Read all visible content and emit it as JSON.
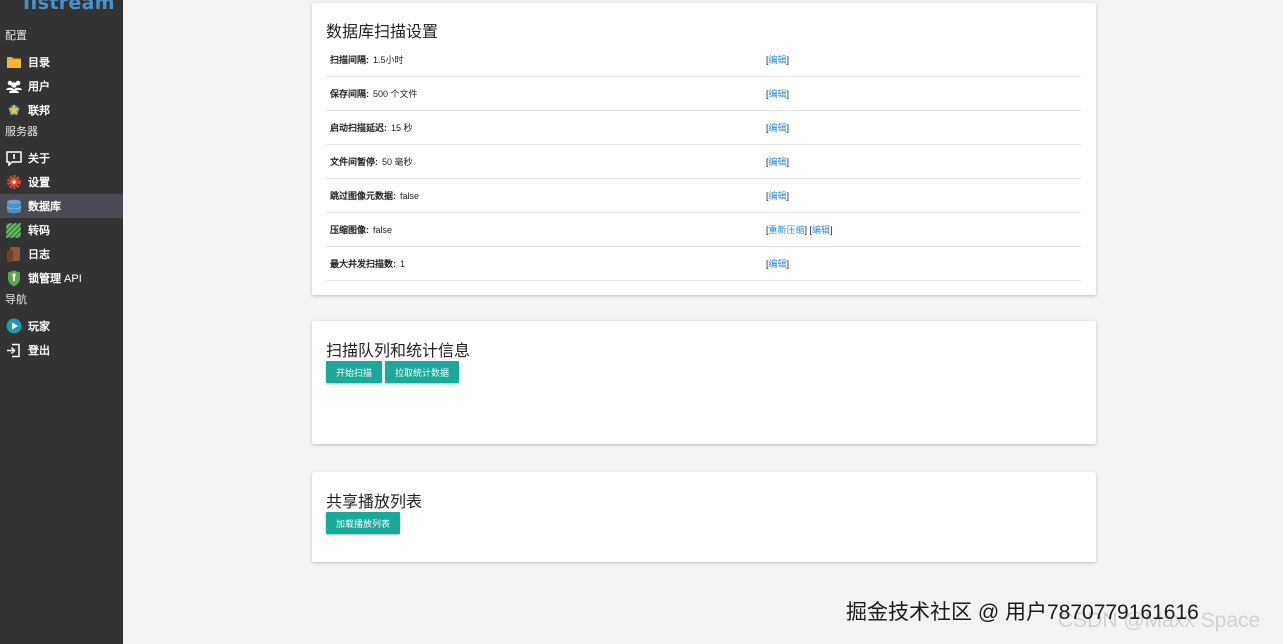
{
  "app": {
    "logo_text": "IIstream",
    "brand_color": "#4d8fc9"
  },
  "sidebar": {
    "sections": [
      {
        "heading": "配置",
        "items": [
          {
            "label": "目录",
            "icon": "folder-icon"
          },
          {
            "label": "用户",
            "icon": "users-icon"
          },
          {
            "label": "联邦",
            "icon": "federation-icon"
          }
        ]
      },
      {
        "heading": "服务器",
        "items": [
          {
            "label": "关于",
            "icon": "info-icon"
          },
          {
            "label": "设置",
            "icon": "gear-icon"
          },
          {
            "label": "数据库",
            "icon": "database-icon",
            "active": true
          },
          {
            "label": "转码",
            "icon": "transcode-icon"
          },
          {
            "label": "日志",
            "icon": "log-icon"
          },
          {
            "label": "锁管理",
            "label_suffix": " API",
            "icon": "lock-icon"
          }
        ]
      },
      {
        "heading": "导航",
        "items": [
          {
            "label": "玩家",
            "icon": "play-icon"
          },
          {
            "label": "登出",
            "icon": "logout-icon"
          }
        ]
      }
    ]
  },
  "db_settings": {
    "title": "数据库扫描设置",
    "rows": [
      {
        "label": "扫描间隔:",
        "value": "1.5小时",
        "actions": [
          "编辑"
        ]
      },
      {
        "label": "保存间隔:",
        "value": "500 个文件",
        "actions": [
          "编辑"
        ]
      },
      {
        "label": "启动扫描延迟:",
        "value": "15 秒",
        "actions": [
          "编辑"
        ]
      },
      {
        "label": "文件间暂停:",
        "value": "50 毫秒",
        "actions": [
          "编辑"
        ]
      },
      {
        "label": "跳过图像元数据:",
        "value": "false",
        "actions": [
          "编辑"
        ]
      },
      {
        "label": "压缩图像:",
        "value": "false",
        "actions": [
          "重新压缩",
          "编辑"
        ]
      },
      {
        "label": "最大并发扫描数:",
        "value": "1",
        "actions": [
          "编辑"
        ]
      }
    ]
  },
  "scan_queue": {
    "title": "扫描队列和统计信息",
    "start_scan_label": "开始扫描",
    "pull_stats_label": "拉取统计数据"
  },
  "shared_playlists": {
    "title": "共享播放列表",
    "load_label": "加载播放列表"
  },
  "watermark": {
    "text": "掘金技术社区 @ 用户787077916161​6",
    "background_text": "CSDN @Maxx Space"
  },
  "colors": {
    "sidebar_bg": "#333333",
    "active_item_bg": "#4a4a52",
    "button_bg": "#1aa899",
    "link": "#2a8ccf",
    "page_bg": "#f3f3f3"
  }
}
